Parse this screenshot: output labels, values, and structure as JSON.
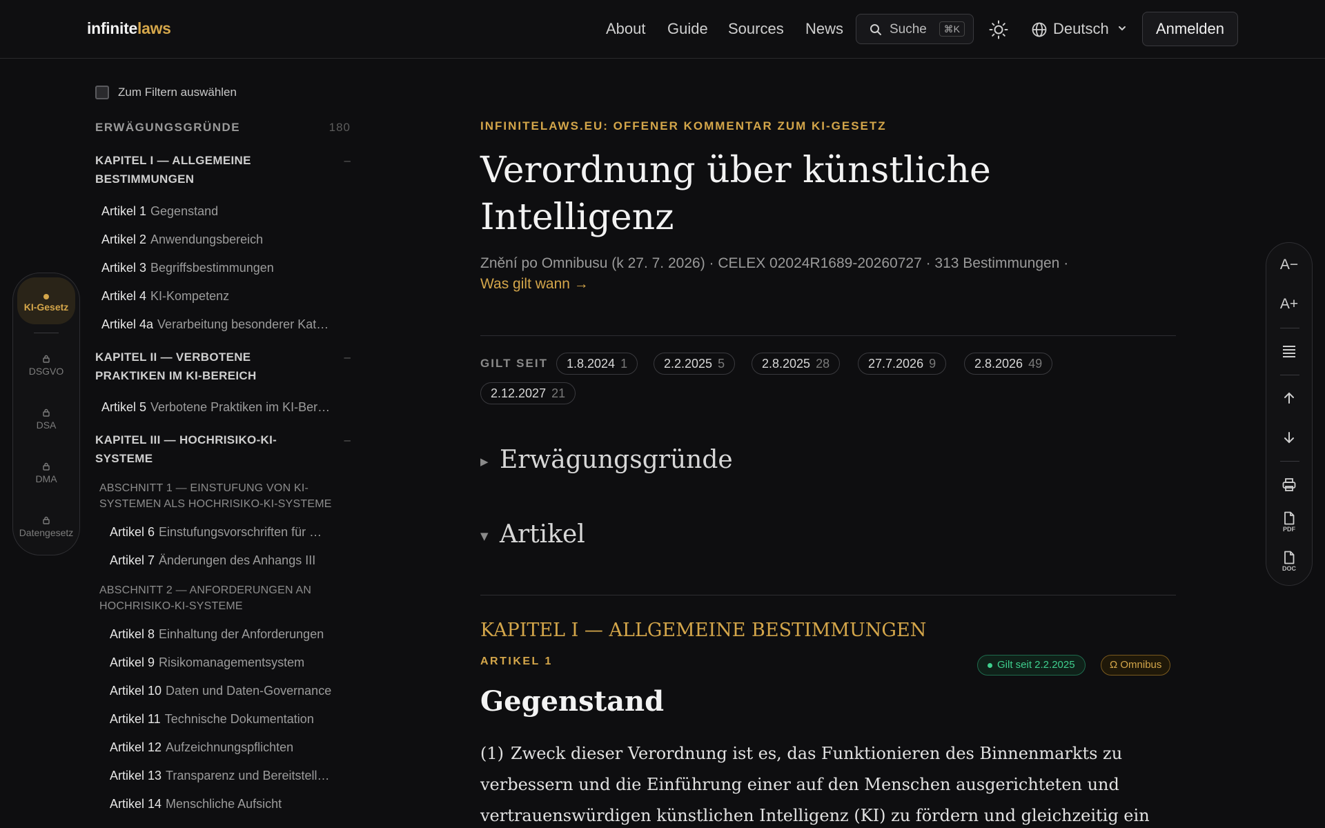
{
  "header": {
    "logo_part1": "infinite",
    "logo_part2": "laws",
    "nav": [
      "About",
      "Guide",
      "Sources",
      "News"
    ],
    "search_label": "Suche",
    "search_shortcut": "⌘K",
    "language": "Deutsch",
    "login_label": "Anmelden"
  },
  "rail": {
    "items": [
      {
        "label": "KI-Gesetz",
        "active": true
      },
      {
        "label": "DSGVO",
        "active": false
      },
      {
        "label": "DSA",
        "active": false
      },
      {
        "label": "DMA",
        "active": false
      },
      {
        "label": "Datengesetz",
        "active": false
      }
    ]
  },
  "sidebar": {
    "filter_label": "Zum Filtern auswählen",
    "recitals_label": "ERWÄGUNGSGRÜNDE",
    "recitals_count": "180",
    "chapters": [
      {
        "title": "KAPITEL I — ALLGEMEINE BESTIMMUNGEN",
        "toggle": "–",
        "articles": [
          {
            "num": "Artikel 1",
            "title": "Gegenstand"
          },
          {
            "num": "Artikel 2",
            "title": "Anwendungsbereich"
          },
          {
            "num": "Artikel 3",
            "title": "Begriffsbestimmungen"
          },
          {
            "num": "Artikel 4",
            "title": "KI-Kompetenz"
          },
          {
            "num": "Artikel 4a",
            "title": "Verarbeitung besonderer Kat…"
          }
        ]
      },
      {
        "title": "KAPITEL II — VERBOTENE PRAKTIKEN IM KI-BEREICH",
        "toggle": "–",
        "articles": [
          {
            "num": "Artikel 5",
            "title": "Verbotene Praktiken im KI-Ber…"
          }
        ]
      },
      {
        "title": "KAPITEL III — HOCHRISIKO-KI-SYSTEME",
        "toggle": "–",
        "sections": [
          {
            "title": "ABSCHNITT 1 — EINSTUFUNG VON KI-SYSTEMEN ALS HOCHRISIKO-KI-SYSTEME",
            "articles": [
              {
                "num": "Artikel 6",
                "title": "Einstufungsvorschriften für …"
              },
              {
                "num": "Artikel 7",
                "title": "Änderungen des Anhangs III"
              }
            ]
          },
          {
            "title": "ABSCHNITT 2 — ANFORDERUNGEN AN HOCHRISIKO-KI-SYSTEME",
            "articles": [
              {
                "num": "Artikel 8",
                "title": "Einhaltung der Anforderungen"
              },
              {
                "num": "Artikel 9",
                "title": "Risikomanagementsystem"
              },
              {
                "num": "Artikel 10",
                "title": "Daten und Daten-Governance"
              },
              {
                "num": "Artikel 11",
                "title": "Technische Dokumentation"
              },
              {
                "num": "Artikel 12",
                "title": "Aufzeichnungspflichten"
              },
              {
                "num": "Artikel 13",
                "title": "Transparenz und Bereitstell…"
              },
              {
                "num": "Artikel 14",
                "title": "Menschliche Aufsicht"
              }
            ]
          }
        ]
      }
    ]
  },
  "main": {
    "eyebrow": "INFINITELAWS.EU: OFFENER KOMMENTAR ZUM KI-GESETZ",
    "title": "Verordnung über künstliche Intelligenz",
    "meta": "Znění po Omnibusu (k 27. 7. 2026) · CELEX 02024R1689-20260727 · 313 Bestimmungen ·",
    "meta_link": "Was gilt wann →",
    "gilt_label": "GILT SEIT",
    "dates": [
      {
        "date": "1.8.2024",
        "count": "1"
      },
      {
        "date": "2.2.2025",
        "count": "5"
      },
      {
        "date": "2.8.2025",
        "count": "28"
      },
      {
        "date": "27.7.2026",
        "count": "9"
      },
      {
        "date": "2.8.2026",
        "count": "49"
      },
      {
        "date": "2.12.2027",
        "count": "21"
      }
    ],
    "recitals_toggle": "Erwägungsgründe",
    "articles_toggle": "Artikel",
    "chapter_heading": "KAPITEL I — ALLGEMEINE BESTIMMUNGEN",
    "article_label": "ARTIKEL 1",
    "badge_valid": "Gilt seit 2.2.2025",
    "badge_omnibus": "Ω Omnibus",
    "article_title": "Gegenstand",
    "paragraph_num": "(1)",
    "paragraph_text": "Zweck dieser Verordnung ist es, das Funktionieren des Binnenmarkts zu verbessern und die Einführung einer auf den Menschen ausgerichteten und vertrauenswürdigen künstlichen Intelligenz (KI) zu fördern und gleichzeitig ein"
  },
  "tools": {
    "font_smaller": "A−",
    "font_larger": "A+",
    "pdf_label": "PDF",
    "doc_label": "DOC"
  },
  "colors": {
    "accent": "#d4a64a",
    "background": "#0e0e10",
    "green": "#3fcf8e"
  }
}
